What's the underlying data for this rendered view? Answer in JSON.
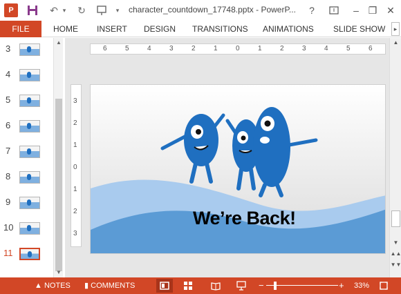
{
  "app": {
    "icon_letter": "P",
    "document_title": "character_countdown_17748.pptx - PowerP...",
    "help_label": "?",
    "qat": {
      "save_icon": "save-icon",
      "undo_icon": "undo-icon",
      "redo_icon": "redo-icon",
      "present_icon": "start-presentation-icon"
    }
  },
  "ribbon": {
    "file_tab": "FILE",
    "tabs": [
      "HOME",
      "INSERT",
      "DESIGN",
      "TRANSITIONS",
      "ANIMATIONS",
      "SLIDE SHOW"
    ],
    "accent": "#d24726"
  },
  "thumbnails": {
    "numbers": [
      "3",
      "4",
      "5",
      "6",
      "7",
      "8",
      "9",
      "10",
      "11"
    ],
    "active": "11"
  },
  "rulers": {
    "horizontal": [
      "6",
      "5",
      "4",
      "3",
      "2",
      "1",
      "0",
      "1",
      "2",
      "3",
      "4",
      "5",
      "6"
    ],
    "vertical": [
      "3",
      "2",
      "1",
      "0",
      "1",
      "2",
      "3"
    ]
  },
  "slide": {
    "text": "We’re Back!",
    "wave_color": "#5b9bd5",
    "character_color": "#1f6fc0"
  },
  "status_bar": {
    "notes_label": "NOTES",
    "comments_label": "COMMENTS",
    "zoom_label": "33%",
    "zoom_minus": "−",
    "zoom_plus": "+",
    "zoom_level": 0.33
  }
}
